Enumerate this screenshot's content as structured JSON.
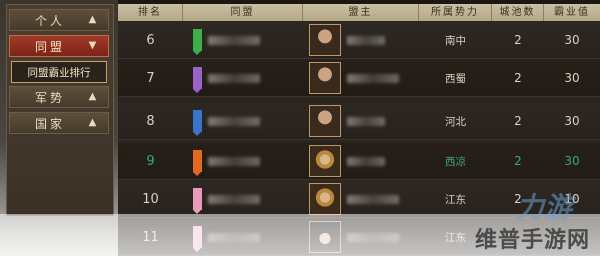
{
  "menu": {
    "personal": "个人",
    "league": "同盟",
    "league_ranking": "同盟霸业排行",
    "military": "军势",
    "nation": "国家"
  },
  "table": {
    "headers": [
      "排名",
      "同盟",
      "盟主",
      "所属势力",
      "城池数",
      "霸业值"
    ],
    "rows": [
      {
        "rank": "6",
        "banner_color": "#3fae4a",
        "region": "南中",
        "cities": "2",
        "score": "30",
        "avatar": "male-beard"
      },
      {
        "rank": "7",
        "banner_color": "#9a63c9",
        "region": "西蜀",
        "cities": "2",
        "score": "30",
        "avatar": "male-long-hair"
      },
      {
        "rank": "8",
        "banner_color": "#3a74c9",
        "region": "河北",
        "cities": "2",
        "score": "30",
        "avatar": "male-beard"
      },
      {
        "rank": "9",
        "banner_color": "#e06a1f",
        "region": "西凉",
        "cities": "2",
        "score": "30",
        "avatar": "male-helmet",
        "highlight": "green"
      },
      {
        "rank": "10",
        "banner_color": "#e79bbd",
        "region": "江东",
        "cities": "2",
        "score": "10",
        "avatar": "male-helmet"
      },
      {
        "rank": "11",
        "banner_color": "#f0b4cf",
        "region": "江东",
        "cities": "",
        "score": "",
        "avatar": "female"
      }
    ]
  },
  "watermark": {
    "logo": "力游",
    "text": "维普手游网"
  }
}
